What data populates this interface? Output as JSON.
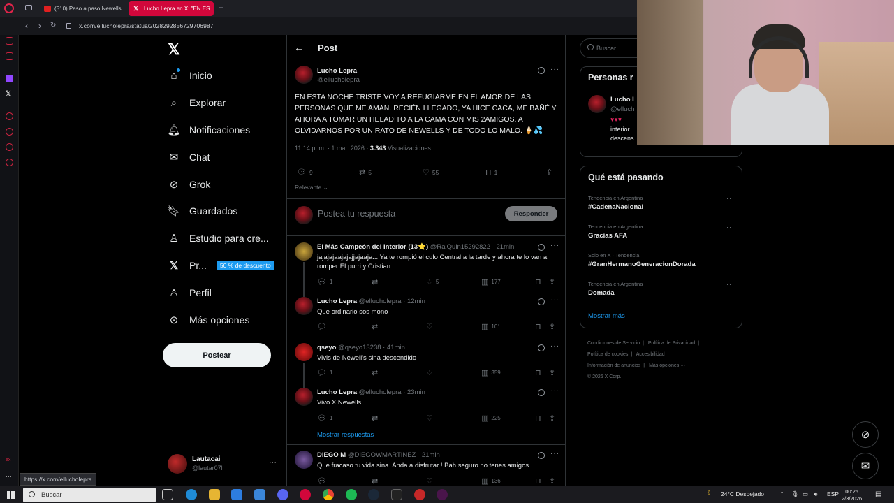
{
  "browser": {
    "tabs": [
      {
        "label": "(510) Paso a paso Newells",
        "icon": "youtube-icon",
        "active": false
      },
      {
        "label": "Lucho Lepra en X: \"EN ES",
        "icon": "x-icon",
        "active": true
      }
    ],
    "url": "x.com/ellucholepra/status/2028292856729706987",
    "status_url": "https://x.com/ellucholepra"
  },
  "nav": {
    "items": [
      {
        "label": "Inicio",
        "icon": "home-icon"
      },
      {
        "label": "Explorar",
        "icon": "search-icon"
      },
      {
        "label": "Notificaciones",
        "icon": "bell-icon"
      },
      {
        "label": "Chat",
        "icon": "mail-icon"
      },
      {
        "label": "Grok",
        "icon": "grok-icon"
      },
      {
        "label": "Guardados",
        "icon": "bookmark-icon"
      },
      {
        "label": "Estudio para cre...",
        "icon": "creator-studio-icon"
      },
      {
        "label": "Pr...",
        "icon": "x-premium-icon",
        "badge": "50 % de descuento"
      },
      {
        "label": "Perfil",
        "icon": "profile-icon"
      },
      {
        "label": "Más opciones",
        "icon": "more-options-icon"
      }
    ],
    "post_button": "Postear",
    "account": {
      "name": "Lautacai",
      "handle": "@lautar07l"
    }
  },
  "post": {
    "header": "Post",
    "author": {
      "name": "Lucho Lepra",
      "handle": "@ellucholepra"
    },
    "text": "EN ESTA NOCHE TRISTE VOY A REFUGIARME EN EL AMOR DE LAS PERSONAS QUE ME AMAN. RECIÉN LLEGADO, YA HICE CACA, ME BAÑÉ Y AHORA A TOMAR UN HELADITO A LA CAMA CON MIS 2AMIGOS. A OLVIDARNOS POR UN RATO DE NEWELLS Y DE TODO LO MALO. 🍦💦",
    "time": "11:14 p. m. · 1 mar. 2026 ·",
    "views_count": "3.343",
    "views_label": "Visualizaciones",
    "replies": "9",
    "reposts": "5",
    "likes": "55",
    "bookmarks": "1",
    "sort": "Relevante",
    "reply_placeholder": "Postea tu respuesta",
    "reply_button": "Responder"
  },
  "comments": [
    {
      "name": "El Más Campeón del Interior (13⭐)",
      "handle": "@RaiQuin15292822",
      "time": "· 21min",
      "text": "jajajajaajajajjajaaja... Ya te rompió el culo Central a la tarde y ahora te lo van a romper El purri y Cristian...",
      "replies": "1",
      "reposts": "",
      "likes": "5",
      "views": "177"
    },
    {
      "name": "Lucho Lepra",
      "handle": "@ellucholepra",
      "time": "· 12min",
      "text": "Que ordinario sos mono",
      "replies": "",
      "reposts": "",
      "likes": "",
      "views": "101"
    },
    {
      "name": "qseyo",
      "handle": "@qseyo13238",
      "time": "· 41min",
      "text": "Vivis de Newell's sina descendido",
      "replies": "1",
      "reposts": "",
      "likes": "",
      "views": "359"
    },
    {
      "name": "Lucho Lepra",
      "handle": "@ellucholepra",
      "time": "· 23min",
      "text": "Vivo X Newells",
      "replies": "1",
      "reposts": "",
      "likes": "",
      "views": "225"
    },
    {
      "name": "DIEGO M",
      "handle": "@DIEGOWMARTINEZ",
      "time": "· 21min",
      "text": "Que fracaso tu vida sina. Anda a disfrutar ! Bah seguro no tenes amigos.",
      "replies": "",
      "reposts": "",
      "likes": "",
      "views": "136"
    }
  ],
  "show_replies": "Mostrar respuestas",
  "right": {
    "search_placeholder": "Buscar",
    "people_title": "Personas r",
    "people_name": "Lucho L",
    "people_handle": "@elluch",
    "people_bio_1": "interior",
    "people_bio_2": "descens",
    "trends_title": "Qué está pasando",
    "trends": [
      {
        "context": "Tendencia en Argentina",
        "name": "#CadenaNacional"
      },
      {
        "context": "Tendencia en Argentina",
        "name": "Gracias AFA"
      },
      {
        "context": "Solo en X · Tendencia",
        "name": "#GranHermanoGeneracionDorada"
      },
      {
        "context": "Tendencia en Argentina",
        "name": "Domada"
      }
    ],
    "show_more": "Mostrar más",
    "footer": [
      "Condiciones de Servicio",
      "|",
      "Política de Privacidad",
      "|",
      "Política de cookies",
      "|",
      "Accesibilidad",
      "|",
      "Información de anuncios",
      "|",
      "Más opciones ···",
      "© 2026 X Corp."
    ]
  },
  "taskbar": {
    "search": "Buscar",
    "weather": "24°C  Despejado",
    "lang": "ESP",
    "time": "00:25",
    "date": "2/3/2026"
  },
  "colors": {
    "accent": "#1d9bf0",
    "opera_red": "#d1073b",
    "background": "#000000"
  }
}
